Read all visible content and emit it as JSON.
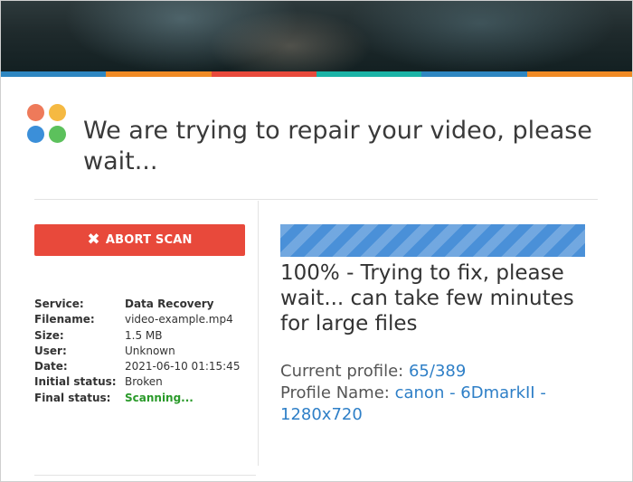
{
  "colors": {
    "stripe": [
      "#2e86c1",
      "#f08a24",
      "#e8493b",
      "#1bb3a6",
      "#2e86c1",
      "#f08a24"
    ],
    "logo": [
      "#ee7a5a",
      "#f5b942",
      "#3b8fd9",
      "#5cc15c"
    ],
    "abort_button": "#e8493b",
    "progress_bar": "#4a90d8",
    "scanning": "#2a9a2a",
    "link": "#2e7fc7"
  },
  "header": {
    "title": "We are trying to repair your video, please wait..."
  },
  "abort_button": {
    "icon": "close-icon",
    "label": "ABORT SCAN"
  },
  "info": {
    "service_label": "Service:",
    "service_value": "Data Recovery",
    "filename_label": "Filename:",
    "filename_value": "video-example.mp4",
    "size_label": "Size:",
    "size_value": "1.5 MB",
    "user_label": "User:",
    "user_value": "Unknown",
    "date_label": "Date:",
    "date_value": "2021-06-10 01:15:45",
    "initial_status_label": "Initial status:",
    "initial_status_value": "Broken",
    "final_status_label": "Final status:",
    "final_status_value": "Scanning..."
  },
  "progress": {
    "percent": 100,
    "status_text": "100% - Trying to fix, please wait... can take few minutes for large files"
  },
  "profile": {
    "current_label": "Current profile:",
    "current_value": "65/389",
    "name_label": "Profile Name:",
    "name_value": "canon - 6DmarkII - 1280x720"
  }
}
